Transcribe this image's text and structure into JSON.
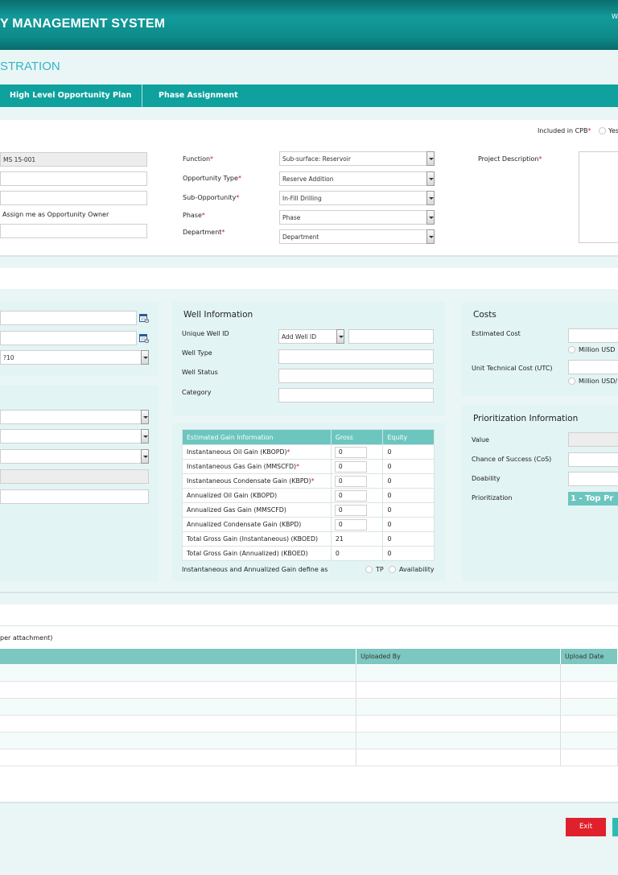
{
  "header": {
    "title": "Y MANAGEMENT SYSTEM",
    "welcome": "W"
  },
  "page_title": "STRATION",
  "tabs": [
    {
      "label": "High Level Opportunity Plan"
    },
    {
      "label": "Phase Assignment"
    }
  ],
  "general": {
    "cpb_label": "Included in CPB",
    "cpb_yes": "Yes",
    "opportunity_id": "MS 15-001",
    "assign_owner": "Assign me as Opportunity Owner",
    "function_label": "Function",
    "function_value": "Sub-surface: Reservoir",
    "type_label": "Opportunity Type",
    "type_value": "Reserve Addition",
    "sub_label": "Sub-Opportunity",
    "sub_value": "In-Fill Drilling",
    "phase_label": "Phase",
    "phase_value": "Phase",
    "dept_label": "Department",
    "dept_value": "Department",
    "desc_label": "Project Description",
    "required_mark": "*"
  },
  "left": {
    "select_value": "?10"
  },
  "well": {
    "title": "Well Information",
    "uwi_label": "Unique Well ID",
    "add_well": "Add Well ID",
    "type_label": "Well Type",
    "status_label": "Well Status",
    "category_label": "Category"
  },
  "gain": {
    "headers": [
      "Estimated Gain Information",
      "Gross",
      "Equity"
    ],
    "rows": [
      {
        "label": "Instantaneous Oil Gain (KBOPD)",
        "req": "*",
        "gross": "0",
        "equity": "0"
      },
      {
        "label": "Instantaneous Gas Gain (MMSCFD)",
        "req": "*",
        "gross": "0",
        "equity": "0"
      },
      {
        "label": "Instantaneous Condensate Gain (KBPD)",
        "req": "*",
        "gross": "0",
        "equity": "0"
      },
      {
        "label": "Annualized Oil Gain (KBOPD)",
        "req": "",
        "gross": "0",
        "equity": "0"
      },
      {
        "label": "Annualized Gas Gain (MMSCFD)",
        "req": "",
        "gross": "0",
        "equity": "0"
      },
      {
        "label": "Annualized Condensate Gain (KBPD)",
        "req": "",
        "gross": "0",
        "equity": "0"
      },
      {
        "label": "Total Gross Gain (Instantaneous) (KBOED)",
        "req": "",
        "gross": "21",
        "equity": "0"
      },
      {
        "label": "Total Gross Gain (Annualized) (KBOED)",
        "req": "",
        "gross": "0",
        "equity": "0"
      }
    ],
    "define_label": "Instantaneous and Annualized Gain define as",
    "opt_tp": "TP",
    "opt_avail": "Availability"
  },
  "costs": {
    "title": "Costs",
    "est_label": "Estimated Cost",
    "est_unit": "Million USD",
    "utc_label": "Unit Technical Cost (UTC)",
    "utc_unit": "Million USD/"
  },
  "prio": {
    "title": "Prioritization Information",
    "value_label": "Value",
    "cos_label": "Chance of Success (CoS)",
    "doability_label": "Doability",
    "prio_label": "Prioritization",
    "prio_value": "1 - Top Pr"
  },
  "attachments": {
    "note": "per attachment)",
    "col_uploaded_by": "Uploaded By",
    "col_upload_date": "Upload Date"
  },
  "buttons": {
    "exit": "Exit"
  },
  "colors": {
    "header": "#0e8a8a",
    "tabbar": "#0ea19d",
    "title": "#35b4c4",
    "table_head": "#6cc6bf",
    "exit": "#e0202c",
    "prio_badge": "#6cc6bf"
  }
}
